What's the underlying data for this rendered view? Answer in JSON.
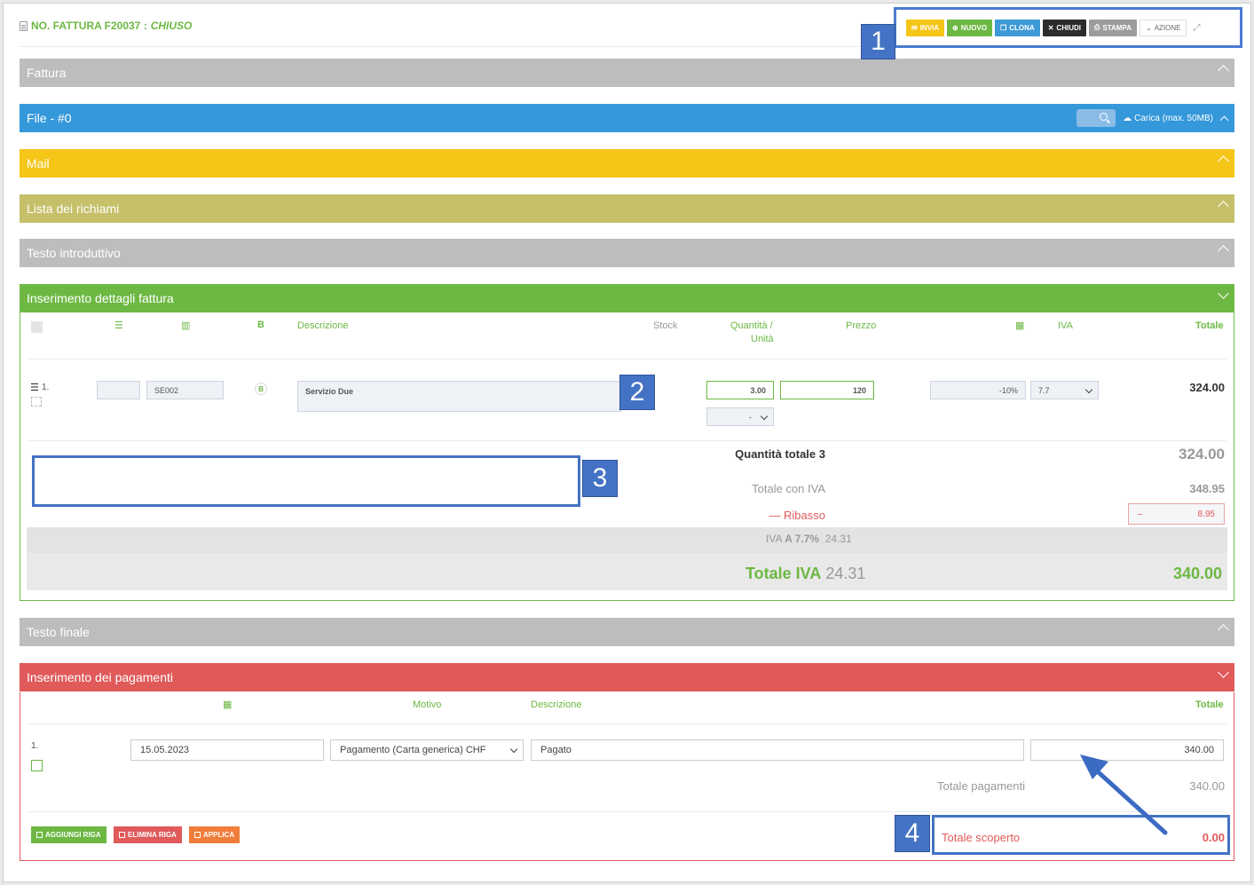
{
  "header": {
    "title": "NO. FATTURA F20037 :",
    "status": "CHIUSO",
    "buttons": {
      "invia": "INVIA",
      "nuovo": "NUOVO",
      "clona": "CLONA",
      "chiudi": "CHIUDI",
      "stampa": "STAMPA",
      "azione": "AZIONE"
    }
  },
  "panels": {
    "fattura": "Fattura",
    "file": "File - #0",
    "file_upload": "Carica (max. 50MB)",
    "mail": "Mail",
    "richiami": "Lista dei richiami",
    "testo_intro": "Testo introduttivo",
    "dettagli": "Inserimento dettagli fattura",
    "testo_finale": "Testo finale",
    "pagamenti": "Inserimento dei pagamenti"
  },
  "details": {
    "columns": {
      "b": "B",
      "descrizione": "Descrizione",
      "stock": "Stock",
      "quantita": "Quantità /",
      "unita": "Unità",
      "prezzo": "Prezzo",
      "iva": "IVA",
      "totale": "Totale"
    },
    "row": {
      "index": "1.",
      "code": "SE002",
      "badge": "B",
      "description": "Servizio Due",
      "quantity": "3.00",
      "unit_select": "-",
      "price": "120",
      "discount": "-10%",
      "vat": "7.7",
      "total": "324.00"
    },
    "summary": {
      "qty_label": "Quantità totale 3",
      "qty_value": "324.00",
      "con_iva_label": "Totale con IVA",
      "con_iva_value": "348.95",
      "ribasso_label": "Ribasso",
      "ribasso_value": "8.95",
      "iva_line_prefix": "IVA",
      "iva_line_rate": "A 7.7%",
      "iva_line_value": "24.31",
      "totale_iva_label": "Totale IVA",
      "totale_iva_value": "24.31",
      "grand_total": "340.00"
    }
  },
  "payments": {
    "columns": {
      "motivo": "Motivo",
      "descrizione": "Descrizione",
      "totale": "Totale"
    },
    "row": {
      "index": "1.",
      "date": "15.05.2023",
      "motivo": "Pagamento (Carta generica) CHF",
      "descrizione": "Pagato",
      "amount": "340.00"
    },
    "totale_pagamenti_label": "Totale pagamenti",
    "totale_pagamenti_value": "340.00",
    "scoperto_label": "Totale scoperto",
    "scoperto_value": "0.00",
    "buttons": {
      "add": "AGGIUNGI RIGA",
      "delete": "ELIMINA RIGA",
      "apply": "APPLICA"
    }
  },
  "callouts": [
    "1",
    "2",
    "3",
    "4"
  ],
  "colors": {
    "green": "#6cb843",
    "blue": "#3498db",
    "yellow": "#f5c518",
    "red": "#e05a5a",
    "callout": "#4472c4"
  }
}
